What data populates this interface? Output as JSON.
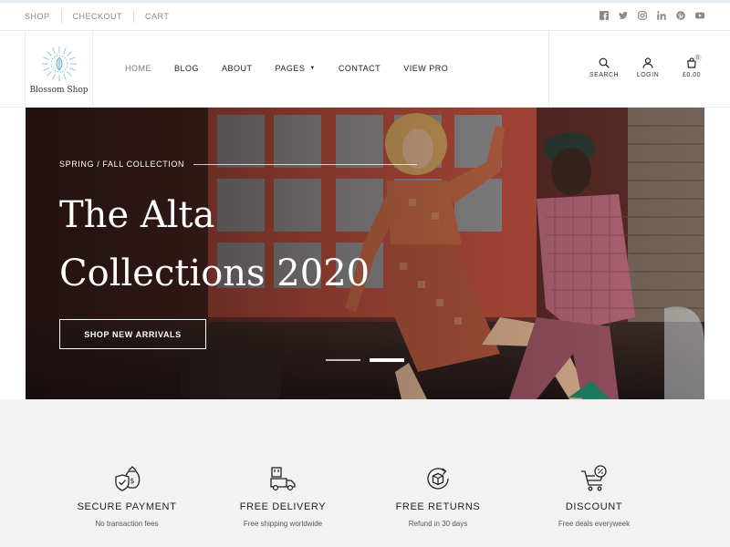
{
  "topbar": {
    "links": [
      "SHOP",
      "CHECKOUT",
      "CART"
    ],
    "socials": [
      "facebook-icon",
      "twitter-icon",
      "instagram-icon",
      "linkedin-icon",
      "pinterest-icon",
      "youtube-icon"
    ]
  },
  "header": {
    "logo_text": "Blossom Shop",
    "nav": [
      {
        "label": "HOME",
        "active": true
      },
      {
        "label": "BLOG"
      },
      {
        "label": "ABOUT"
      },
      {
        "label": "PAGES",
        "has_dropdown": true
      },
      {
        "label": "CONTACT"
      },
      {
        "label": "VIEW PRO"
      }
    ],
    "actions": {
      "search_label": "SEARCH",
      "login_label": "LOGIN",
      "cart_label": "£0.00",
      "cart_count": "0"
    }
  },
  "hero": {
    "subtitle": "SPRING / FALL COLLECTION",
    "title_line1": "The Alta",
    "title_line2": "Collections 2020",
    "button_label": "SHOP NEW ARRIVALS",
    "active_slide": 2,
    "slide_count": 2
  },
  "features": [
    {
      "icon": "money-bag-shield-icon",
      "title": "SECURE PAYMENT",
      "desc": "No transaction fees"
    },
    {
      "icon": "delivery-truck-icon",
      "title": "FREE DELIVERY",
      "desc": "Free shipping worldwide"
    },
    {
      "icon": "returns-box-icon",
      "title": "FREE RETURNS",
      "desc": "Refund in 30 days"
    },
    {
      "icon": "discount-cart-icon",
      "title": "DISCOUNT",
      "desc": "Free deals everyweek"
    }
  ],
  "colors": {
    "accent": "#222222",
    "muted": "#8a8a8a",
    "feature_bg": "#f2f2f2",
    "hero_overlay": "#140a0a"
  }
}
